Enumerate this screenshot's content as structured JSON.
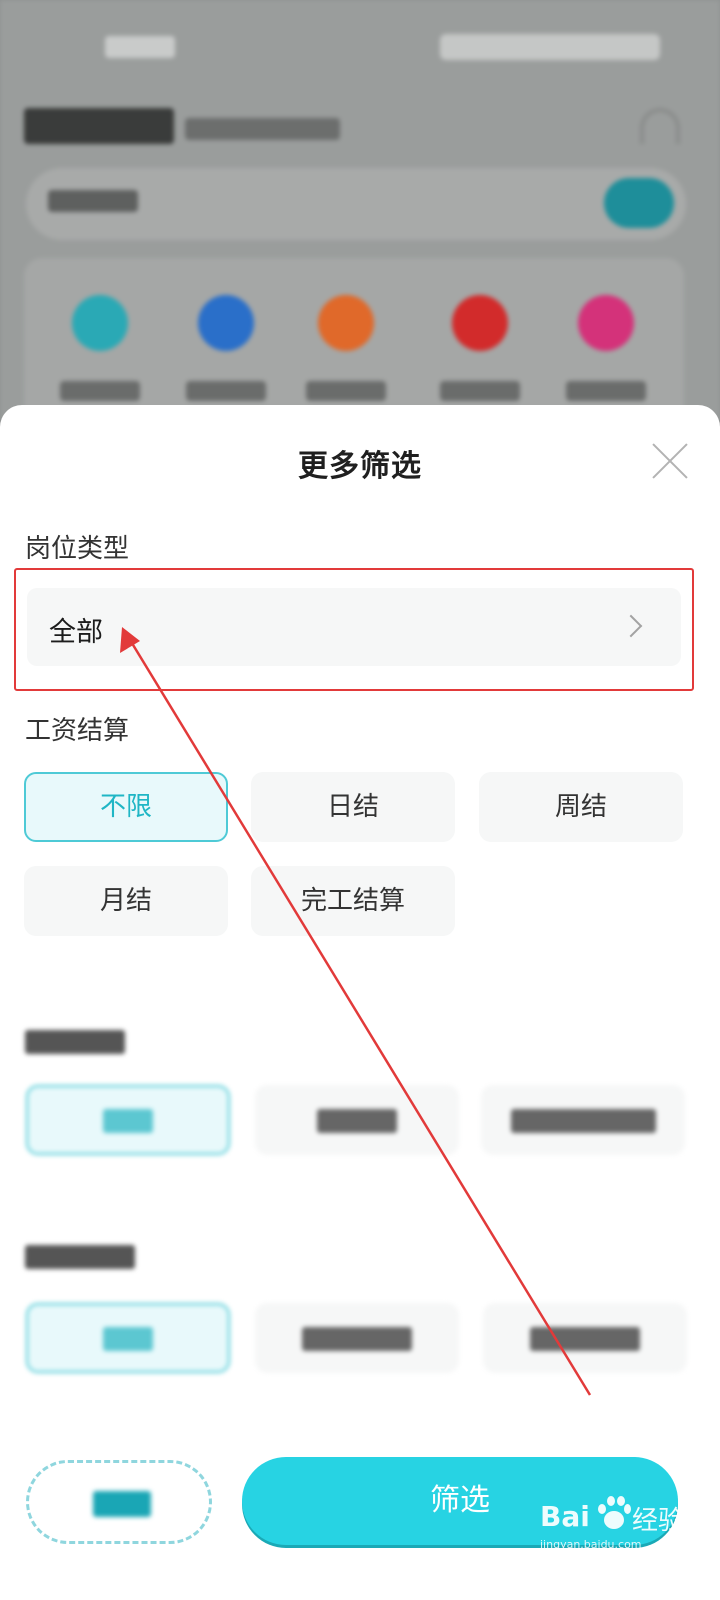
{
  "sheet": {
    "title": "更多筛选",
    "job_type": {
      "label": "岗位类型",
      "value": "全部"
    },
    "salary_settlement": {
      "label": "工资结算",
      "options": [
        "不限",
        "日结",
        "周结",
        "月结",
        "完工结算"
      ],
      "selected": "不限"
    },
    "filter_label": "筛选"
  },
  "watermark": {
    "brand": "Bai",
    "brand_cn": "经验",
    "url": "jingyan.baidu.com"
  },
  "colors": {
    "accent": "#27d3e3",
    "selected_bg": "#e8f9fb",
    "annotation": "#e23a3a"
  }
}
